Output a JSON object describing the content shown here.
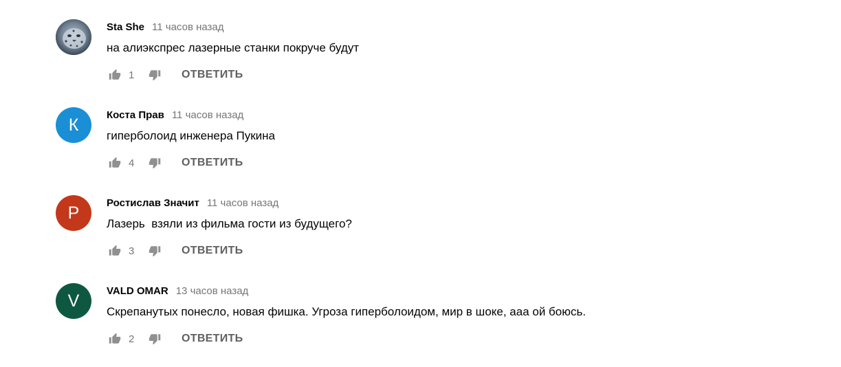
{
  "colors": {
    "avatar_k": "#1a8fd6",
    "avatar_p": "#c3371a",
    "avatar_v": "#0e5841"
  },
  "comments": [
    {
      "author": "Sta She",
      "time": "11 часов назад",
      "text": "на алиэкспрес лазерные станки покруче будут",
      "likes": "1",
      "reply": "ОТВЕТИТЬ",
      "avatar_letter": ""
    },
    {
      "author": "Коста Прав",
      "time": "11 часов назад",
      "text": "гиперболоид инженера Пукина",
      "likes": "4",
      "reply": "ОТВЕТИТЬ",
      "avatar_letter": "К"
    },
    {
      "author": "Ростислав Значит",
      "time": "11 часов назад",
      "text": "Лазерь  взяли из фильма гости из будущего?",
      "likes": "3",
      "reply": "ОТВЕТИТЬ",
      "avatar_letter": "Р"
    },
    {
      "author": "VALD OMAR",
      "time": "13 часов назад",
      "text": "Скрепанутых понесло, новая фишка. Угроза гиперболоидом, мир в шоке, ааа ой боюсь.",
      "likes": "2",
      "reply": "ОТВЕТИТЬ",
      "avatar_letter": "V"
    }
  ]
}
